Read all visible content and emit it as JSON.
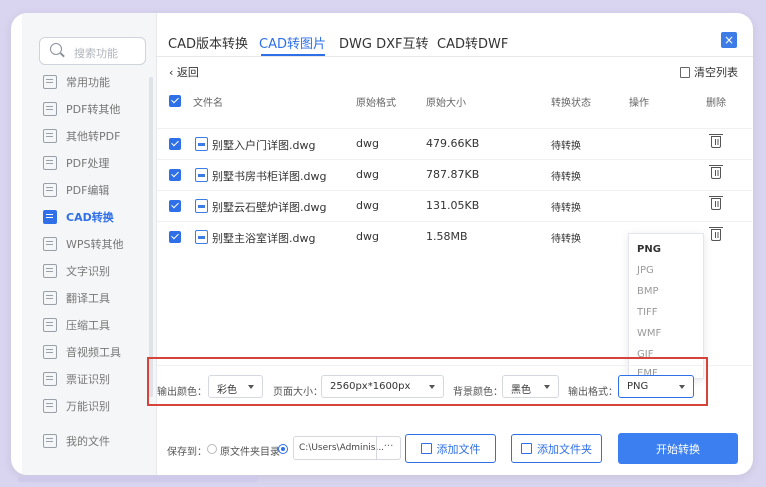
{
  "search": {
    "placeholder": "搜索功能"
  },
  "sidebar": {
    "items": [
      {
        "label": "常用功能",
        "active": false
      },
      {
        "label": "PDF转其他",
        "active": false
      },
      {
        "label": "其他转PDF",
        "active": false
      },
      {
        "label": "PDF处理",
        "active": false
      },
      {
        "label": "PDF编辑",
        "active": false
      },
      {
        "label": "CAD转换",
        "active": true
      },
      {
        "label": "WPS转其他",
        "active": false
      },
      {
        "label": "文字识别",
        "active": false
      },
      {
        "label": "翻译工具",
        "active": false
      },
      {
        "label": "压缩工具",
        "active": false
      },
      {
        "label": "音视频工具",
        "active": false
      },
      {
        "label": "票证识别",
        "active": false
      },
      {
        "label": "万能识别",
        "active": false
      },
      {
        "label": "我的文件",
        "active": false
      }
    ]
  },
  "tabs": [
    {
      "label": "CAD版本转换",
      "active": false
    },
    {
      "label": "CAD转图片",
      "active": true
    },
    {
      "label": "DWG DXF互转",
      "active": false
    },
    {
      "label": "CAD转DWF",
      "active": false
    }
  ],
  "toolbar": {
    "back_label": "返回",
    "clear_label": "清空列表",
    "close_glyph": "×"
  },
  "table": {
    "headers": {
      "name": "文件名",
      "format": "原始格式",
      "size": "原始大小",
      "status": "转换状态",
      "action": "操作",
      "delete": "删除"
    },
    "rows": [
      {
        "name": "别墅入户门详图.dwg",
        "format": "dwg",
        "size": "479.66KB",
        "status": "待转换"
      },
      {
        "name": "别墅书房书柜详图.dwg",
        "format": "dwg",
        "size": "787.87KB",
        "status": "待转换"
      },
      {
        "name": "别墅云石壁炉详图.dwg",
        "format": "dwg",
        "size": "131.05KB",
        "status": "待转换"
      },
      {
        "name": "别墅主浴室详图.dwg",
        "format": "dwg",
        "size": "1.58MB",
        "status": "待转换"
      }
    ]
  },
  "format_dropdown": {
    "options": [
      "PNG",
      "JPG",
      "BMP",
      "TIFF",
      "WMF",
      "GIF",
      "EMF"
    ],
    "selected": "PNG"
  },
  "options": {
    "color_label": "输出颜色：",
    "color_value": "彩色",
    "page_size_label": "页面大小：",
    "page_size_value": "2560px*1600px",
    "bg_label": "背景颜色：",
    "bg_value": "黑色",
    "format_label": "输出格式：",
    "format_value": "PNG"
  },
  "footer": {
    "save_to_label": "保存到：",
    "source_dir_label": "原文件夹目录",
    "path_value": "C:\\Users\\Adminis...",
    "path_more": "···",
    "add_file_label": "添加文件",
    "add_folder_label": "添加文件夹",
    "start_label": "开始转换"
  },
  "colors": {
    "accent": "#2f6fe8",
    "highlight_border": "#d6433a",
    "background": "#d9d4ef"
  }
}
